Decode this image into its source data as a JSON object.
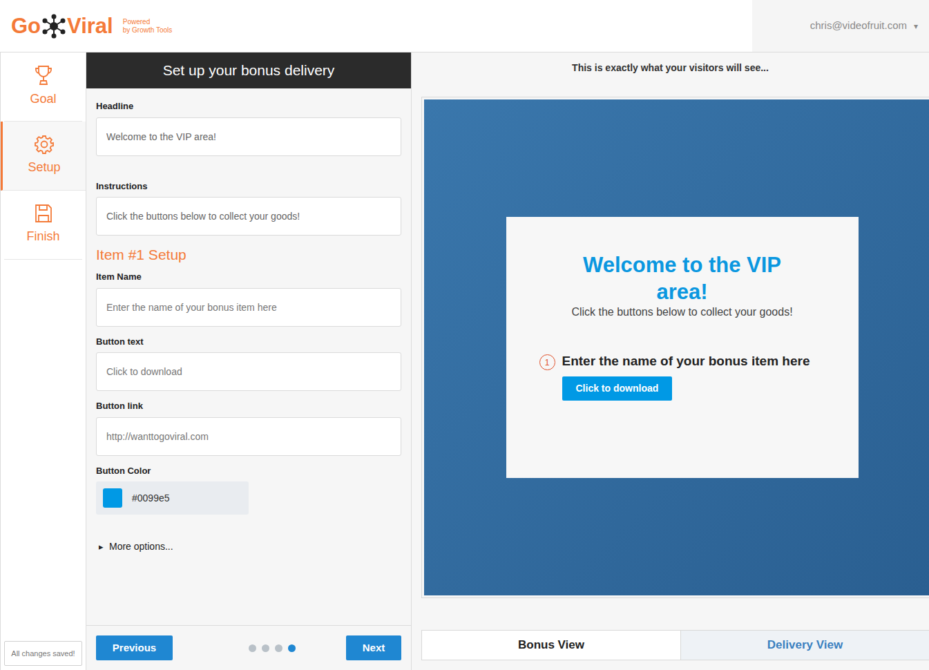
{
  "header": {
    "logo": {
      "prefix": "Go",
      "suffix": "Viral",
      "tagline_1": "Powered",
      "tagline_2": "by Growth Tools"
    },
    "user": {
      "email": "chris@videofruit.com",
      "caret": "▾"
    }
  },
  "sidebar": {
    "items": [
      {
        "label": "Goal",
        "selected": false
      },
      {
        "label": "Setup",
        "selected": true
      },
      {
        "label": "Finish",
        "selected": false
      }
    ],
    "status": "All changes saved!"
  },
  "form": {
    "title": "Set up your bonus delivery",
    "headline": {
      "label": "Headline",
      "value": "Welcome to the VIP area!"
    },
    "instructions": {
      "label": "Instructions",
      "value": "Click the buttons below to collect your goods!"
    },
    "item_heading": "Item #1 Setup",
    "item_name": {
      "label": "Item Name",
      "placeholder": "Enter the name of your bonus item here"
    },
    "button_text": {
      "label": "Button text",
      "placeholder": "Click to download"
    },
    "button_link": {
      "label": "Button link",
      "placeholder": "http://wanttogoviral.com"
    },
    "button_color": {
      "label": "Button Color",
      "value": "#0099e5",
      "color": "#0099e5"
    },
    "more_options": {
      "arrow": "▸",
      "label": "More options...",
      "expanded": false
    }
  },
  "footer": {
    "previous": "Previous",
    "next": "Next",
    "steps": [
      {
        "selected": false
      },
      {
        "selected": false
      },
      {
        "selected": false
      },
      {
        "selected": true
      }
    ]
  },
  "preview": {
    "caption": "This is exactly what your visitors will see...",
    "card": {
      "headline": "Welcome to the VIP area!",
      "instructions": "Click the buttons below to collect your goods!",
      "items": [
        {
          "number": "1",
          "name": "Enter the name of your bonus item here",
          "button": "Click to download",
          "color": "#0099e5"
        }
      ]
    },
    "tabs": [
      {
        "label": "Bonus View",
        "selected": true
      },
      {
        "label": "Delivery View",
        "selected": false
      }
    ]
  }
}
